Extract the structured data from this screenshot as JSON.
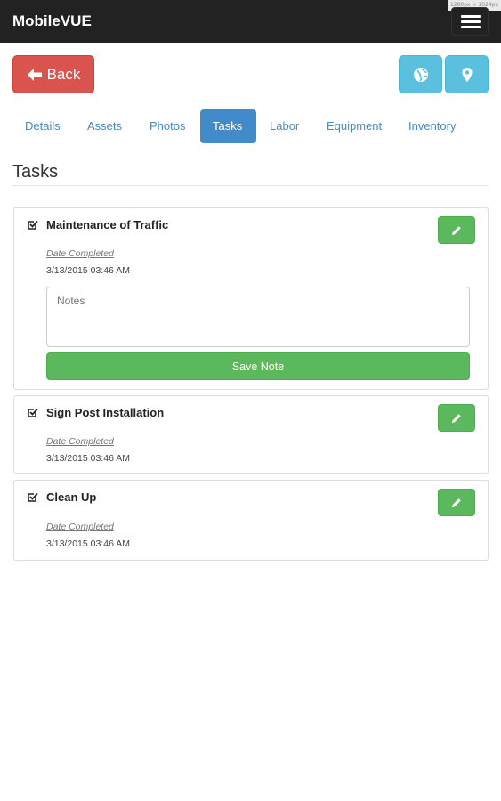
{
  "app": {
    "title": "MobileVUE",
    "tooltip": "1280px × 1024px"
  },
  "header": {
    "back_label": "Back",
    "icons": [
      "globe-icon",
      "map-marker-icon",
      "hamburger-menu-icon"
    ]
  },
  "tabs": [
    {
      "label": "Details",
      "active": false
    },
    {
      "label": "Assets",
      "active": false
    },
    {
      "label": "Photos",
      "active": false
    },
    {
      "label": "Tasks",
      "active": true
    },
    {
      "label": "Labor",
      "active": false
    },
    {
      "label": "Equipment",
      "active": false
    },
    {
      "label": "Inventory",
      "active": false
    }
  ],
  "page": {
    "title": "Tasks"
  },
  "tasks": [
    {
      "title": "Maintenance of Traffic",
      "date_label": "Date Completed",
      "date_value": "3/13/2015 03:46 AM",
      "notes_placeholder": "Notes",
      "save_label": "Save Note"
    },
    {
      "title": "Sign Post Installation",
      "date_label": "Date Completed",
      "date_value": "3/13/2015 03:46 AM"
    },
    {
      "title": "Clean Up",
      "date_label": "Date Completed",
      "date_value": "3/13/2015 03:46 AM"
    }
  ],
  "colors": {
    "navbar": "#222222",
    "danger": "#d9534f",
    "info": "#5bc0de",
    "primary": "#428bca",
    "success": "#5cb85c"
  }
}
